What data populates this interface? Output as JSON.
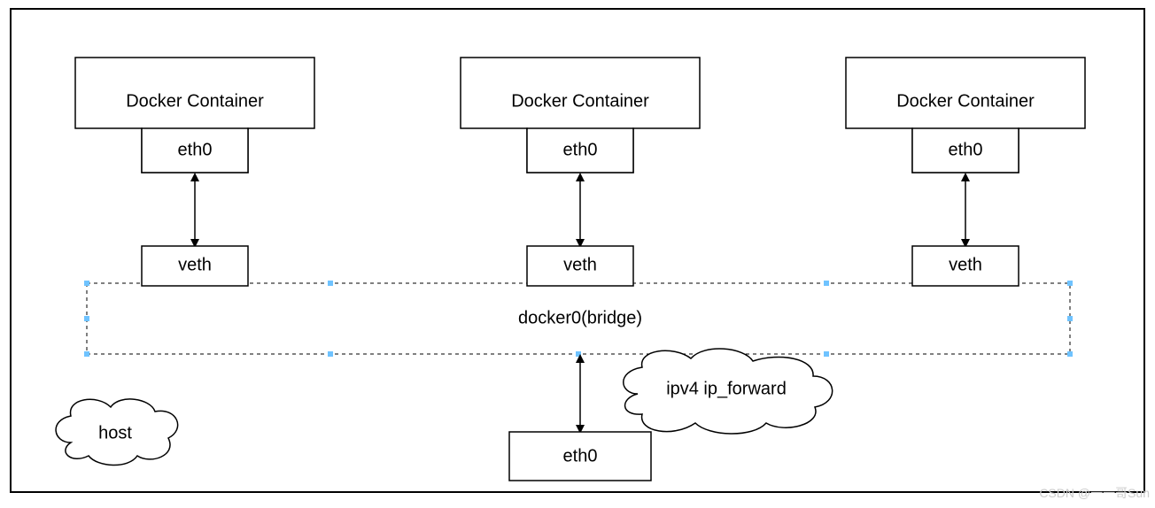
{
  "diagram": {
    "containers": [
      {
        "label": "Docker Container",
        "iface": "eth0",
        "veth": "veth"
      },
      {
        "label": "Docker Container",
        "iface": "eth0",
        "veth": "veth"
      },
      {
        "label": "Docker Container",
        "iface": "eth0",
        "veth": "veth"
      }
    ],
    "bridge_label": "docker0(bridge)",
    "host_cloud": "host",
    "forward_cloud": "ipv4 ip_forward",
    "host_iface": "eth0",
    "watermark": "CSDN @一一哥Sun"
  }
}
